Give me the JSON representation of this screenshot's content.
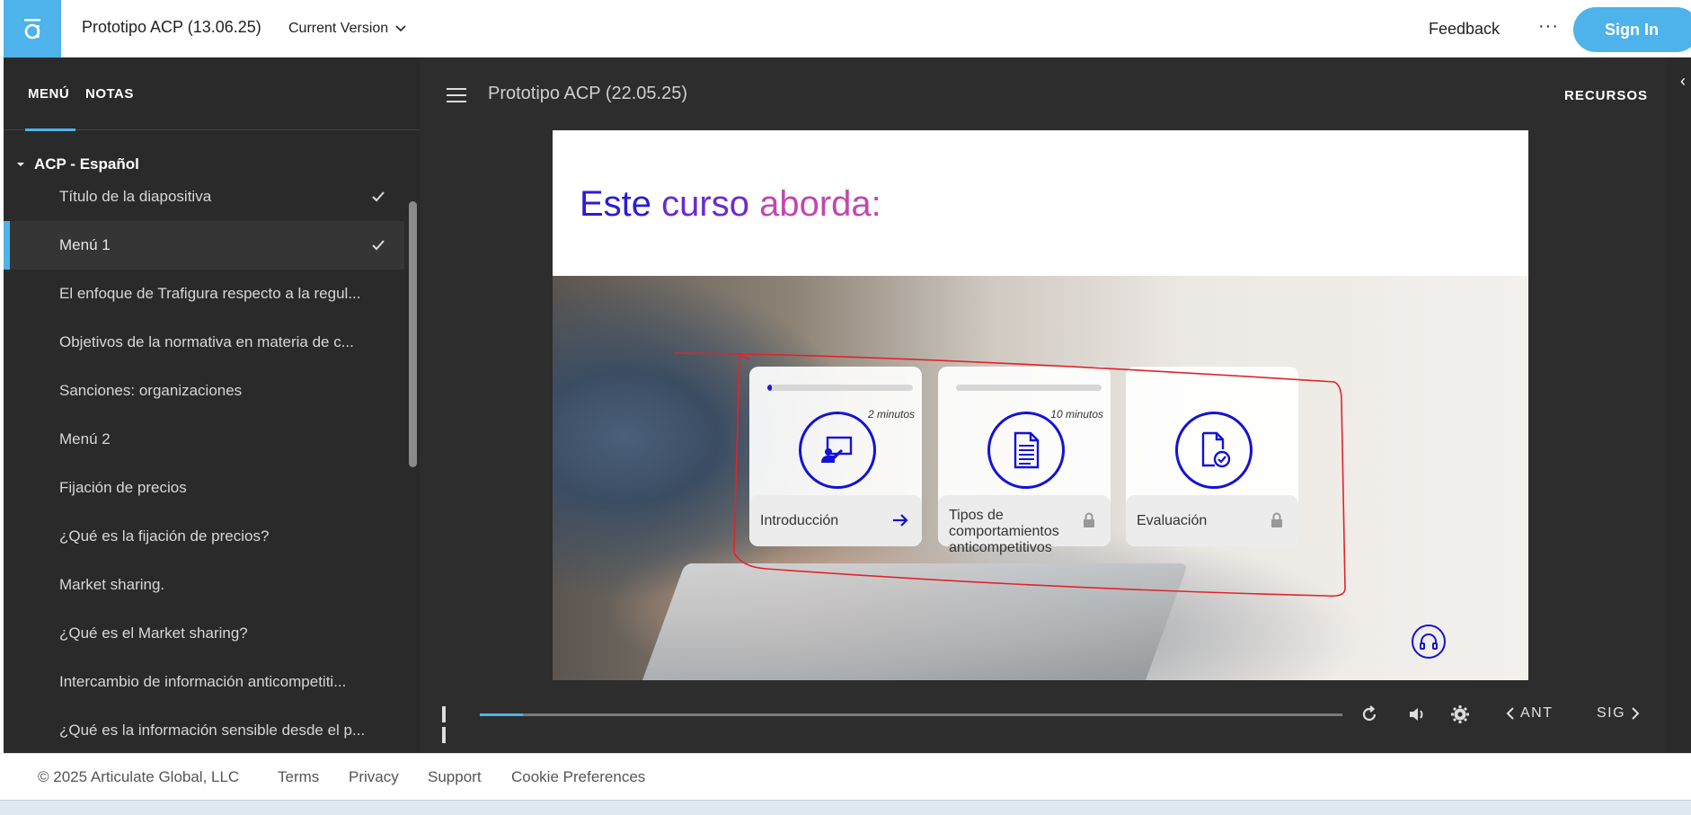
{
  "header": {
    "app_title": "Prototipo ACP (13.06.25)",
    "version_label": "Current Version",
    "feedback": "Feedback",
    "more": "···",
    "sign_in": "Sign In"
  },
  "sidebar": {
    "tabs": [
      {
        "label": "MENÚ",
        "active": true
      },
      {
        "label": "NOTAS",
        "active": false
      }
    ],
    "section": "ACP - Español",
    "items": [
      {
        "label": "Título de la diapositiva",
        "done": true
      },
      {
        "label": "Menú 1",
        "done": true,
        "active": true
      },
      {
        "label": "El enfoque de Trafigura respecto a la regul..."
      },
      {
        "label": "Objetivos de la normativa en materia de c..."
      },
      {
        "label": "Sanciones: organizaciones"
      },
      {
        "label": "Menú 2"
      },
      {
        "label": "Fijación de precios"
      },
      {
        "label": "¿Qué es la fijación de precios?"
      },
      {
        "label": "Market sharing."
      },
      {
        "label": "¿Qué es el Market sharing?"
      },
      {
        "label": "Intercambio de información anticompetiti..."
      },
      {
        "label": "¿Qué es la información sensible desde el p..."
      }
    ]
  },
  "player": {
    "title": "Prototipo ACP (22.05.25)",
    "resources": "RECURSOS",
    "slide": {
      "heading_parts": [
        "Este",
        "curso",
        "aborda:"
      ],
      "cards": [
        {
          "label": "Introducción",
          "duration": "2 minutos",
          "progress": 0.03,
          "state": "open"
        },
        {
          "label": "Tipos de comportamientos anticompetitivos",
          "duration": "10 minutos",
          "progress": 0,
          "state": "locked"
        },
        {
          "label": "Evaluación",
          "duration": "",
          "state": "locked"
        }
      ]
    },
    "controls": {
      "seek_progress": 0.05,
      "prev": "ANT",
      "next": "SIG"
    }
  },
  "footer": {
    "copyright": "© 2025 Articulate Global, LLC",
    "links": [
      "Terms",
      "Privacy",
      "Support",
      "Cookie Preferences"
    ]
  },
  "colors": {
    "accent": "#4db3ea",
    "slide_blue": "#1212d6",
    "sidebar_bg": "#2a2a2a",
    "annotation_red": "#e0242b"
  }
}
